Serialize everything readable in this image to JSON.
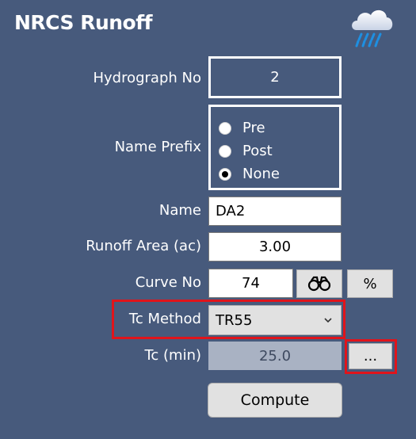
{
  "window": {
    "title": "NRCS Runoff",
    "icon": "rain-cloud-icon"
  },
  "form": {
    "hydrograph_no": {
      "label": "Hydrograph No",
      "value": "2"
    },
    "name_prefix": {
      "label": "Name Prefix",
      "options": [
        "Pre",
        "Post",
        "None"
      ],
      "selected": "None"
    },
    "name": {
      "label": "Name",
      "value": "DA2"
    },
    "runoff_area": {
      "label": "Runoff Area (ac)",
      "value": "3.00"
    },
    "curve_no": {
      "label": "Curve No",
      "value": "74",
      "lookup_icon": "binoculars-icon",
      "percent_label": "%"
    },
    "tc_method": {
      "label": "Tc Method",
      "value": "TR55",
      "dropdown_icon": "chevron-down-icon"
    },
    "tc": {
      "label": "Tc (min)",
      "value": "25.0",
      "browse_label": "..."
    },
    "compute_label": "Compute"
  },
  "colors": {
    "background": "#475a7c",
    "highlight": "#e0141b"
  }
}
